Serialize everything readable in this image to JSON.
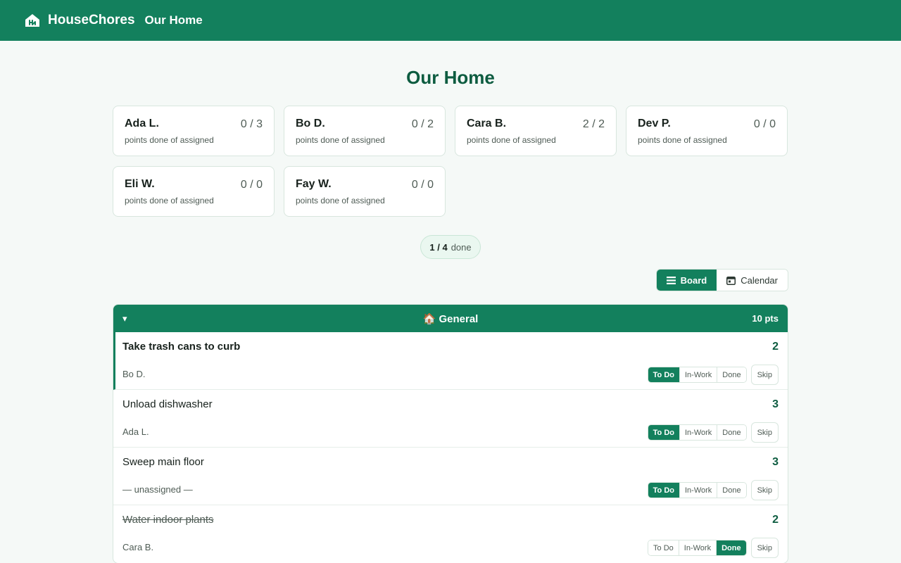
{
  "topbar": {
    "brand": "HouseChores",
    "home_link": "Our Home"
  },
  "page_title": "Our Home",
  "members": [
    {
      "name": "Ada L.",
      "score": "0 / 3",
      "sub": "points done of assigned"
    },
    {
      "name": "Bo D.",
      "score": "0 / 2",
      "sub": "points done of assigned"
    },
    {
      "name": "Cara B.",
      "score": "2 / 2",
      "sub": "points done of assigned"
    },
    {
      "name": "Dev P.",
      "score": "0 / 0",
      "sub": "points done of assigned"
    },
    {
      "name": "Eli W.",
      "score": "0 / 0",
      "sub": "points done of assigned"
    },
    {
      "name": "Fay W.",
      "score": "0 / 0",
      "sub": "points done of assigned"
    }
  ],
  "progress": {
    "count": "1 / 4",
    "label": "done"
  },
  "view_toggle": {
    "board": "Board",
    "calendar": "Calendar",
    "active": "board"
  },
  "board": {
    "collapse_glyph": "▾",
    "title": "🏠 General",
    "points": "10 pts",
    "status_labels": {
      "todo": "To Do",
      "inwork": "In-Work",
      "done": "Done",
      "skip": "Skip"
    },
    "chores": [
      {
        "title": "Take trash cans to curb",
        "points": "2",
        "assignee": "Bo D.",
        "status": "todo"
      },
      {
        "title": "Unload dishwasher",
        "points": "3",
        "assignee": "Ada L.",
        "status": "todo"
      },
      {
        "title": "Sweep main floor",
        "points": "3",
        "assignee": "— unassigned —",
        "status": "todo"
      },
      {
        "title": "Water indoor plants",
        "points": "2",
        "assignee": "Cara B.",
        "status": "done"
      }
    ]
  },
  "colors": {
    "brand": "#13805d",
    "title": "#0d5c40",
    "background": "#f5f9f7"
  }
}
